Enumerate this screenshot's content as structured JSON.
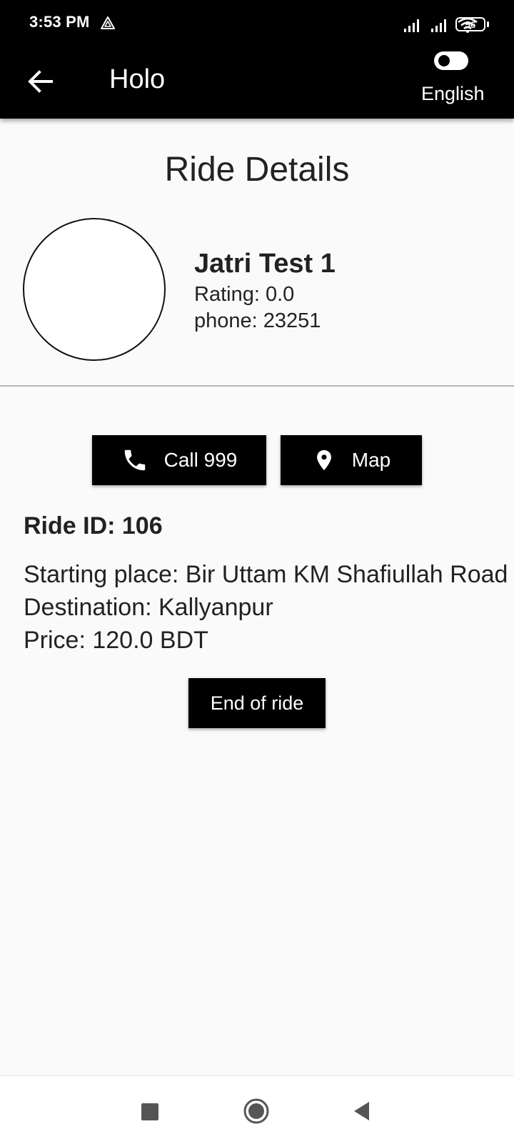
{
  "status_bar": {
    "time": "3:53 PM",
    "battery_level": "56",
    "icons": [
      "drive-icon",
      "signal-icon",
      "signal-icon",
      "wifi-icon",
      "battery-icon"
    ]
  },
  "app_bar": {
    "title": "Holo",
    "language_label": "English",
    "back_icon": "arrow-left-icon"
  },
  "page": {
    "title": "Ride Details"
  },
  "driver": {
    "name": "Jatri Test 1",
    "rating": "Rating: 0.0",
    "phone": "phone: 23251"
  },
  "actions": {
    "call_label": "Call 999",
    "call_icon": "phone-icon",
    "map_label": "Map",
    "map_icon": "location-pin-icon"
  },
  "ride": {
    "id": "Ride ID: 106",
    "starting_place": "Starting place: Bir Uttam KM Shafiullah Road",
    "destination": "Destination: Kallyanpur",
    "price": "Price: 120.0 BDT",
    "end_label": "End of ride"
  },
  "colors": {
    "bar_background": "#000000",
    "page_background": "#fafafa",
    "text": "#222222",
    "divider": "#b5b5b5"
  }
}
